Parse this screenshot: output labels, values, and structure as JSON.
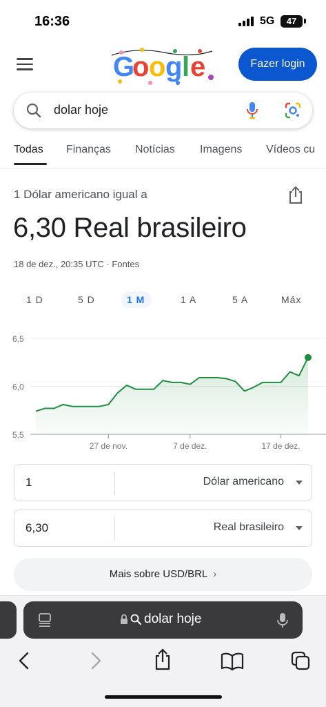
{
  "status_bar": {
    "time": "16:36",
    "network": "5G",
    "battery": "47"
  },
  "header": {
    "login_label": "Fazer login",
    "logo_alt": "Google"
  },
  "search": {
    "query": "dolar hoje"
  },
  "tabs": [
    {
      "label": "Todas",
      "active": true
    },
    {
      "label": "Finanças"
    },
    {
      "label": "Notícias"
    },
    {
      "label": "Imagens"
    },
    {
      "label": "Vídeos cu"
    }
  ],
  "currency": {
    "equal_label": "1 Dólar americano igual a",
    "result": "6,30 Real brasileiro",
    "meta": "18 de dez., 20:35 UTC · Fontes"
  },
  "ranges": [
    {
      "label": "1 D"
    },
    {
      "label": "5 D"
    },
    {
      "label": "1 M",
      "active": true
    },
    {
      "label": "1 A"
    },
    {
      "label": "5 A"
    },
    {
      "label": "Máx"
    }
  ],
  "chart_data": {
    "type": "area",
    "title": "",
    "xlabel": "",
    "ylabel": "",
    "ylim": [
      5.5,
      6.5
    ],
    "y_ticks": [
      "6,5",
      "6,0",
      "5,5"
    ],
    "x_ticks": [
      "27 de nov.",
      "7 de dez.",
      "17 de dez."
    ],
    "color": "#1e8e3e",
    "grid": true,
    "series": [
      {
        "x": [
          0,
          1,
          2,
          3,
          4,
          5,
          6,
          7,
          8,
          9,
          10,
          11,
          12,
          13,
          14,
          15,
          16,
          17,
          18,
          19,
          20,
          21,
          22,
          23,
          24,
          25,
          26,
          27,
          28,
          29,
          30
        ],
        "values": [
          5.74,
          5.77,
          5.77,
          5.81,
          5.79,
          5.79,
          5.79,
          5.79,
          5.81,
          5.93,
          6.01,
          5.97,
          5.97,
          5.97,
          6.06,
          6.04,
          6.04,
          6.02,
          6.09,
          6.09,
          6.09,
          6.08,
          6.05,
          5.95,
          5.99,
          6.04,
          6.04,
          6.04,
          6.15,
          6.11,
          6.3
        ]
      }
    ],
    "x_tick_index": [
      8,
      17,
      27
    ]
  },
  "converter": {
    "from_amount": "1",
    "from_currency": "Dólar americano",
    "to_amount": "6,30",
    "to_currency": "Real brasileiro"
  },
  "more_button": {
    "label": "Mais sobre USD/BRL"
  },
  "safari": {
    "address_text": "dolar hoje"
  }
}
